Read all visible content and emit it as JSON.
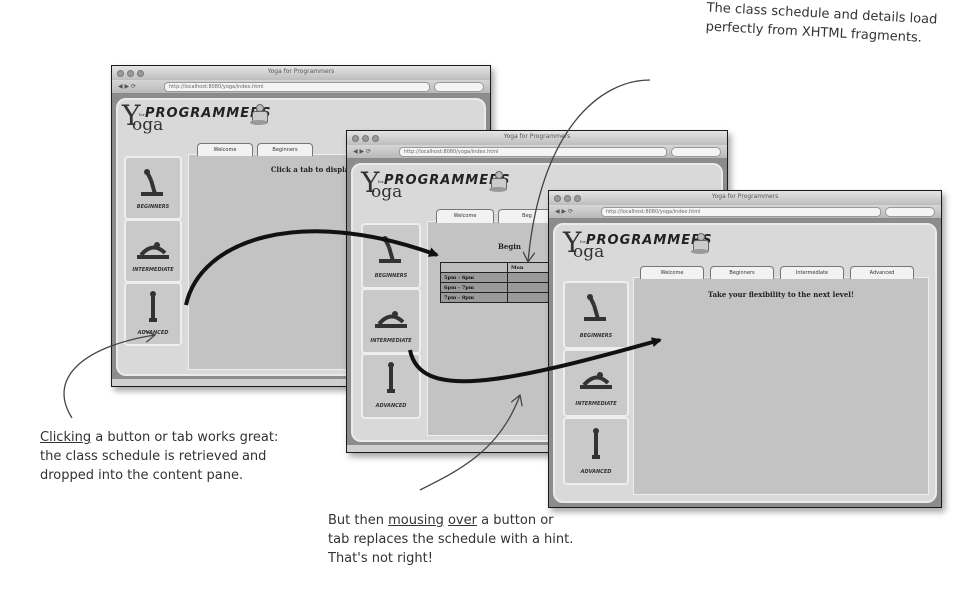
{
  "annotations": {
    "top_right": "The class schedule and details load perfectly from XHTML fragments.",
    "left_1": "Clicking",
    "left_2": " a button or tab works great: the class schedule is retrieved and dropped into the content pane.",
    "bottom_1": "But then ",
    "bottom_2": "mousing",
    "bottom_3": " ",
    "bottom_4": "over",
    "bottom_5": " a button or tab replaces the schedule with a hint. That's not right!"
  },
  "app": {
    "window_title": "Yoga for Programmers",
    "url": "http://localhost:8080/yoga/index.html",
    "logo_y": "Y",
    "logo_oga": "oga",
    "logo_for": "for",
    "logo_programmers": "PROGRAMMERS",
    "side_buttons": [
      "BEGINNERS",
      "INTERMEDIATE",
      "ADVANCED"
    ]
  },
  "window1": {
    "tabs": [
      "Welcome",
      "Beginners"
    ],
    "message": "Click a tab to display the course"
  },
  "window2": {
    "tabs": [
      "Welcome",
      "Beg"
    ],
    "heading": "Begin",
    "schedule_header": [
      "",
      "Mon"
    ],
    "schedule_rows": [
      "5pm - 6pm",
      "6pm - 7pm",
      "7pm - 8pm"
    ]
  },
  "window3": {
    "tabs": [
      "Welcome",
      "Beginners",
      "Intermediate",
      "Advanced"
    ],
    "message": "Take your flexibility to the next level!"
  }
}
